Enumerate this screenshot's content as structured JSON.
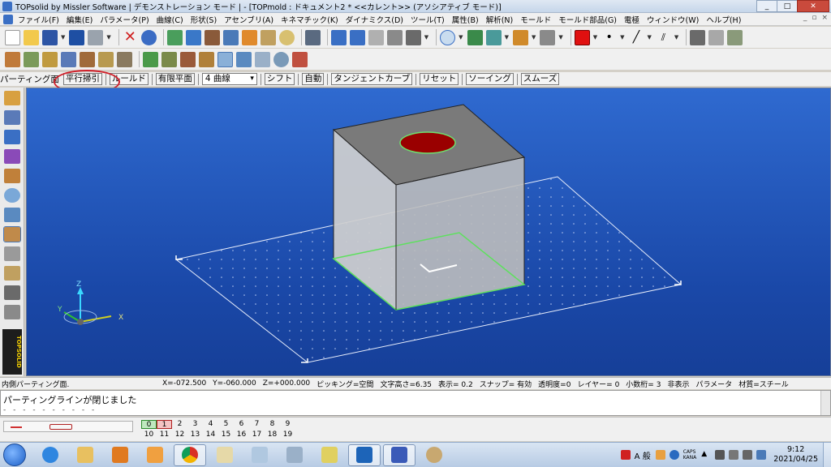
{
  "window": {
    "title": "TOPsolid by Missler Software | デモンストレーション モード | - [TOPmold : ドキュメント2 *  <<カレント>> (アソシアティブ モード)]",
    "buttons": [
      "_",
      "□",
      "✕"
    ]
  },
  "menu": {
    "items": [
      "ファイル(F)",
      "編集(E)",
      "パラメータ(P)",
      "曲線(C)",
      "形状(S)",
      "アセンブリ(A)",
      "キネマチック(K)",
      "ダイナミクス(D)",
      "ツール(T)",
      "属性(B)",
      "解析(N)",
      "モールド",
      "モールド部品(G)",
      "電極",
      "ウィンドウ(W)",
      "ヘルプ(H)"
    ],
    "mdi_buttons": [
      "_",
      "▫",
      "×"
    ]
  },
  "options_bar": {
    "label": "パーティング面",
    "buttons": [
      "平行掃引",
      "ルールド",
      "有限平面"
    ],
    "dropdown_value": "4 曲線",
    "buttons2": [
      "シフト",
      "自動",
      "タンジェントカーブ",
      "リセット",
      "ソーイング",
      "スムーズ"
    ]
  },
  "colors": {
    "viewport_top": "#2f6ad0",
    "viewport_bottom": "#163f98",
    "cube_top": "#7a7a7a",
    "cube_front": "#c9c9c9",
    "cube_side": "#b5b5b5",
    "hole": "#9a0000",
    "hole_rim": "#6ee06e",
    "highlight": "#d0202a",
    "current_color": "#e01010"
  },
  "axes": {
    "z": "Z",
    "y": "Y",
    "x": "X"
  },
  "status": {
    "prompt": "内側パーティング面.",
    "x": "X=-072.500",
    "y": "Y=-060.000",
    "z": "Z=+000.000",
    "picking": "ピッキング=空間",
    "text_height": "文字高さ=6.35",
    "display": "表示=   0.2",
    "snap": "スナップ= 有効",
    "transparency": "透明度=0",
    "layer": "レイヤー=  0",
    "decimals": "小数桁= 3",
    "hidden": "非表示",
    "param": "パラメータ",
    "material": "材質=スチール"
  },
  "command": {
    "message": "パーティングラインが閉じました",
    "dashes": "- - - - - - - - - -"
  },
  "layers": {
    "row1": [
      "0",
      "1",
      "2",
      "3",
      "4",
      "5",
      "6",
      "7",
      "8",
      "9"
    ],
    "row2": [
      "10",
      "11",
      "12",
      "13",
      "14",
      "15",
      "16",
      "17",
      "18",
      "19"
    ]
  },
  "tray": {
    "ime": "A 般",
    "caps": "CAPS",
    "kana": "KANA",
    "time": "9:12",
    "date": "2021/04/25"
  }
}
